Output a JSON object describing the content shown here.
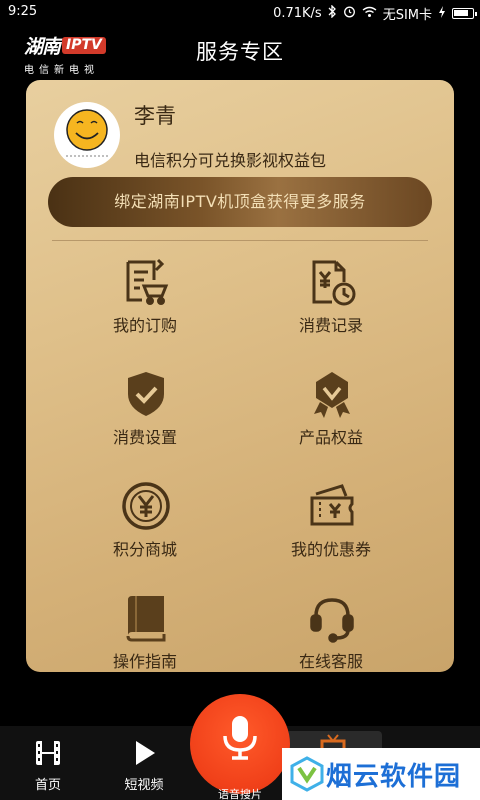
{
  "status_bar": {
    "time": "9:25",
    "speed": "0.71K/s",
    "carrier": "无SIM卡"
  },
  "header": {
    "logo_cn": "湖南",
    "logo_iptv": "IPTV",
    "logo_sub": "电信新电视",
    "title": "服务专区"
  },
  "user": {
    "name": "李青",
    "desc": "电信积分可兑换影视权益包"
  },
  "bind_button": "绑定湖南IPTV机顶盒获得更多服务",
  "grid": [
    {
      "label": "我的订购",
      "icon": "shopping-list-icon"
    },
    {
      "label": "消费记录",
      "icon": "consumption-record-icon"
    },
    {
      "label": "消费设置",
      "icon": "shield-check-icon"
    },
    {
      "label": "产品权益",
      "icon": "medal-badge-icon"
    },
    {
      "label": "积分商城",
      "icon": "yen-coin-icon"
    },
    {
      "label": "我的优惠券",
      "icon": "coupon-wallet-icon"
    },
    {
      "label": "操作指南",
      "icon": "book-icon"
    },
    {
      "label": "在线客服",
      "icon": "headset-icon"
    }
  ],
  "bottom_nav": [
    {
      "label": "首页",
      "icon": "film-icon"
    },
    {
      "label": "短视频",
      "icon": "play-icon"
    },
    {
      "label": "语音搜片",
      "icon": "microphone-icon"
    }
  ],
  "watermark": "烟云软件园",
  "colors": {
    "card_gold": "#dfc08a",
    "bind_brown": "#6b4722",
    "voice_orange": "#f04019",
    "text_brown": "#3a2914"
  }
}
